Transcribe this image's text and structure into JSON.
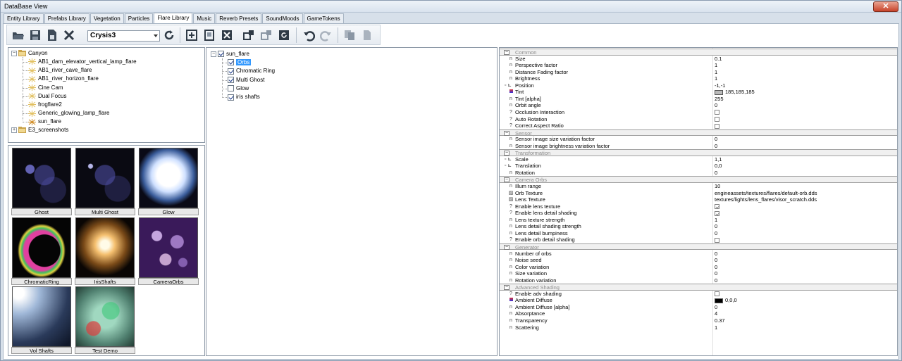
{
  "window": {
    "title": "DataBase View"
  },
  "tabs": [
    "Entity Library",
    "Prefabs Library",
    "Vegetation",
    "Particles",
    "Flare Library",
    "Music",
    "Reverb Presets",
    "SoundMoods",
    "GameTokens"
  ],
  "active_tab": "Flare Library",
  "toolbar": {
    "level_combo": "Crysis3"
  },
  "library_tree": {
    "root": "Canyon",
    "items": [
      "AB1_dam_elevator_vertical_lamp_flare",
      "AB1_river_cave_flare",
      "AB1_river_horizon_flare",
      "Cine Cam",
      "Dual Focus",
      "frogflare2",
      "Generic_glowing_lamp_flare",
      "sun_flare"
    ],
    "second_root": "E3_screenshots"
  },
  "thumbnails": [
    "Ghost",
    "Multi Ghost",
    "Glow",
    "ChromaticRing",
    "IrisShafts",
    "CameraOrbs",
    "Vol Shafts",
    "Test Demo"
  ],
  "flare_tree": {
    "root": "sun_flare",
    "items": [
      {
        "label": "Orbs",
        "checked": true,
        "selected": true
      },
      {
        "label": "Chromatic Ring",
        "checked": true,
        "selected": false
      },
      {
        "label": "Multi Ghost",
        "checked": true,
        "selected": false
      },
      {
        "label": "Glow",
        "checked": false,
        "selected": false
      },
      {
        "label": "iris shafts",
        "checked": true,
        "selected": false
      }
    ]
  },
  "properties": [
    {
      "cat": "Common"
    },
    {
      "icon": "n",
      "name": "Size",
      "value": "0.1"
    },
    {
      "icon": "n",
      "name": "Perspective factor",
      "value": "1"
    },
    {
      "icon": "n",
      "name": "Distance Fading factor",
      "value": "1"
    },
    {
      "icon": "n",
      "name": "Brightness",
      "value": "1"
    },
    {
      "icon": "vec",
      "name": "Position",
      "value": "-1,-1"
    },
    {
      "icon": "color",
      "name": "Tint",
      "value": "185,185,185",
      "swatch": "#b9b9b9"
    },
    {
      "icon": "n",
      "name": "Tint [alpha]",
      "value": "255"
    },
    {
      "icon": "n",
      "name": "Orbit angle",
      "value": "0"
    },
    {
      "icon": "?",
      "name": "Occlusion Interaction",
      "check": false
    },
    {
      "icon": "?",
      "name": "Auto Rotation",
      "check": false
    },
    {
      "icon": "?",
      "name": "Correct Aspect Ratio",
      "check": false
    },
    {
      "cat": "Sensor"
    },
    {
      "icon": "n",
      "name": "Sensor image size variation factor",
      "value": "0"
    },
    {
      "icon": "n",
      "name": "Sensor image brightness variation factor",
      "value": "0"
    },
    {
      "cat": "Transformation"
    },
    {
      "icon": "vec",
      "name": "Scale",
      "value": "1,1"
    },
    {
      "icon": "vec",
      "name": "Translation",
      "value": "0,0"
    },
    {
      "icon": "n",
      "name": "Rotation",
      "value": "0"
    },
    {
      "cat": "Camera Orbs"
    },
    {
      "icon": "n",
      "name": "Illum range",
      "value": "10"
    },
    {
      "icon": "tex",
      "name": "Orb Texture",
      "value": "engineassets/textures/flares/default-orb.dds"
    },
    {
      "icon": "tex",
      "name": "Lens Texture",
      "value": "textures/lights/lens_flares/visor_scratch.dds"
    },
    {
      "icon": "?",
      "name": "Enable lens texture",
      "check": true
    },
    {
      "icon": "?",
      "name": "Enable lens detail shading",
      "check": true
    },
    {
      "icon": "n",
      "name": "Lens texture strength",
      "value": "1"
    },
    {
      "icon": "n",
      "name": "Lens detail shading strength",
      "value": "0"
    },
    {
      "icon": "n",
      "name": "Lens detail bumpiness",
      "value": "0"
    },
    {
      "icon": "?",
      "name": "Enable orb detail shading",
      "check": false
    },
    {
      "cat": "Generator"
    },
    {
      "icon": "n",
      "name": "Number of orbs",
      "value": "0"
    },
    {
      "icon": "n",
      "name": "Noise seed",
      "value": "0"
    },
    {
      "icon": "n",
      "name": "Color variation",
      "value": "0"
    },
    {
      "icon": "n",
      "name": "Size variation",
      "value": "0"
    },
    {
      "icon": "n",
      "name": "Rotation variation",
      "value": "0"
    },
    {
      "cat": "Advanced Shading"
    },
    {
      "icon": "?",
      "name": "Enable adv shading",
      "check": false
    },
    {
      "icon": "color",
      "name": "Ambient Diffuse",
      "value": "0,0,0",
      "swatch": "#000000"
    },
    {
      "icon": "n",
      "name": "Ambient Diffuse [alpha]",
      "value": "0"
    },
    {
      "icon": "n",
      "name": "Absorptance",
      "value": "4"
    },
    {
      "icon": "n",
      "name": "Transparency",
      "value": "0.37"
    },
    {
      "icon": "n",
      "name": "Scattering",
      "value": "1"
    }
  ]
}
